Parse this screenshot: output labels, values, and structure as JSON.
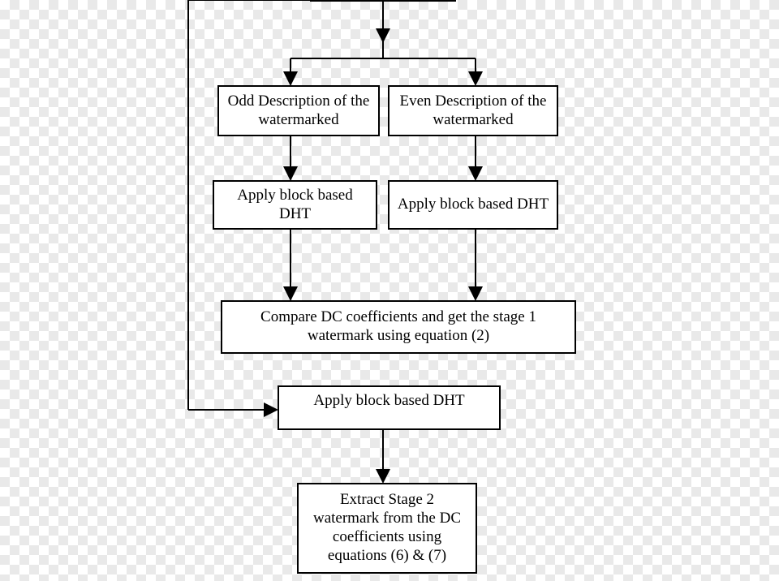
{
  "nodes": {
    "top": {
      "label": ""
    },
    "odd": {
      "label": "Odd Description of the watermarked"
    },
    "even": {
      "label": "Even Description of the watermarked"
    },
    "dht_odd": {
      "label": "Apply block based DHT"
    },
    "dht_even": {
      "label": "Apply block based DHT"
    },
    "compare": {
      "label": "Compare DC coefficients and get the stage 1 watermark using equation (2)"
    },
    "dht_stage2": {
      "label": "Apply block based DHT"
    },
    "extract": {
      "label": "Extract Stage 2 watermark from the DC coefficients using equations (6) & (7)"
    }
  }
}
